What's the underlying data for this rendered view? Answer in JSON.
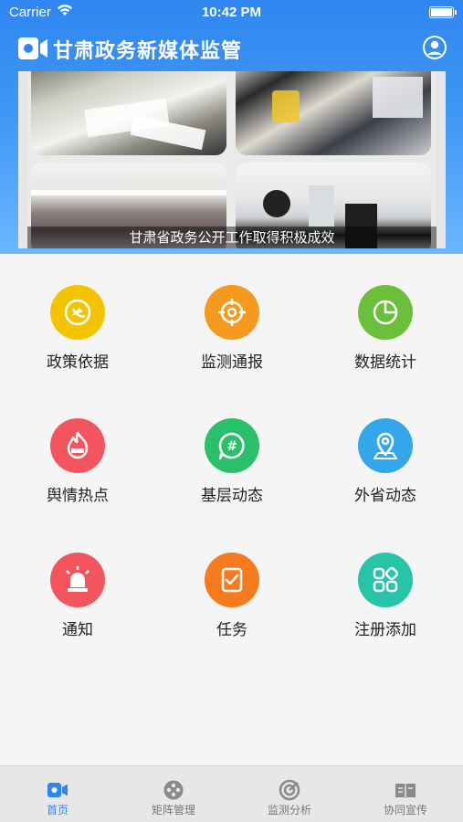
{
  "status_bar": {
    "carrier": "Carrier",
    "time": "10:42 PM"
  },
  "nav": {
    "title": "甘肃政务新媒体监管",
    "logo_icon": "video-camera-icon",
    "profile_icon": "user-profile-icon"
  },
  "banner": {
    "caption": "甘肃省政务公开工作取得积极成效"
  },
  "grid": {
    "items": [
      {
        "label": "政策依据",
        "icon": "party-emblem-icon",
        "color": "#f5c400"
      },
      {
        "label": "监测通报",
        "icon": "target-icon",
        "color": "#f59a1e"
      },
      {
        "label": "数据统计",
        "icon": "pie-chart-icon",
        "color": "#6bbf3a"
      },
      {
        "label": "舆情热点",
        "icon": "fire-icon",
        "color": "#f2555d"
      },
      {
        "label": "基层动态",
        "icon": "hashtag-chat-icon",
        "color": "#2ac06a"
      },
      {
        "label": "外省动态",
        "icon": "map-location-icon",
        "color": "#34a7ea"
      },
      {
        "label": "通知",
        "icon": "alarm-siren-icon",
        "color": "#f2555d"
      },
      {
        "label": "任务",
        "icon": "task-check-icon",
        "color": "#f57b1e"
      },
      {
        "label": "注册添加",
        "icon": "apps-grid-icon",
        "color": "#27c4a8"
      }
    ]
  },
  "tabbar": {
    "tabs": [
      {
        "label": "首页",
        "icon": "home-video-icon",
        "active": true
      },
      {
        "label": "矩阵管理",
        "icon": "matrix-icon",
        "active": false
      },
      {
        "label": "监测分析",
        "icon": "radar-icon",
        "active": false
      },
      {
        "label": "协同宣传",
        "icon": "book-icon",
        "active": false
      }
    ],
    "active_color": "#2f86f0",
    "inactive_color": "#8a8a8a"
  }
}
